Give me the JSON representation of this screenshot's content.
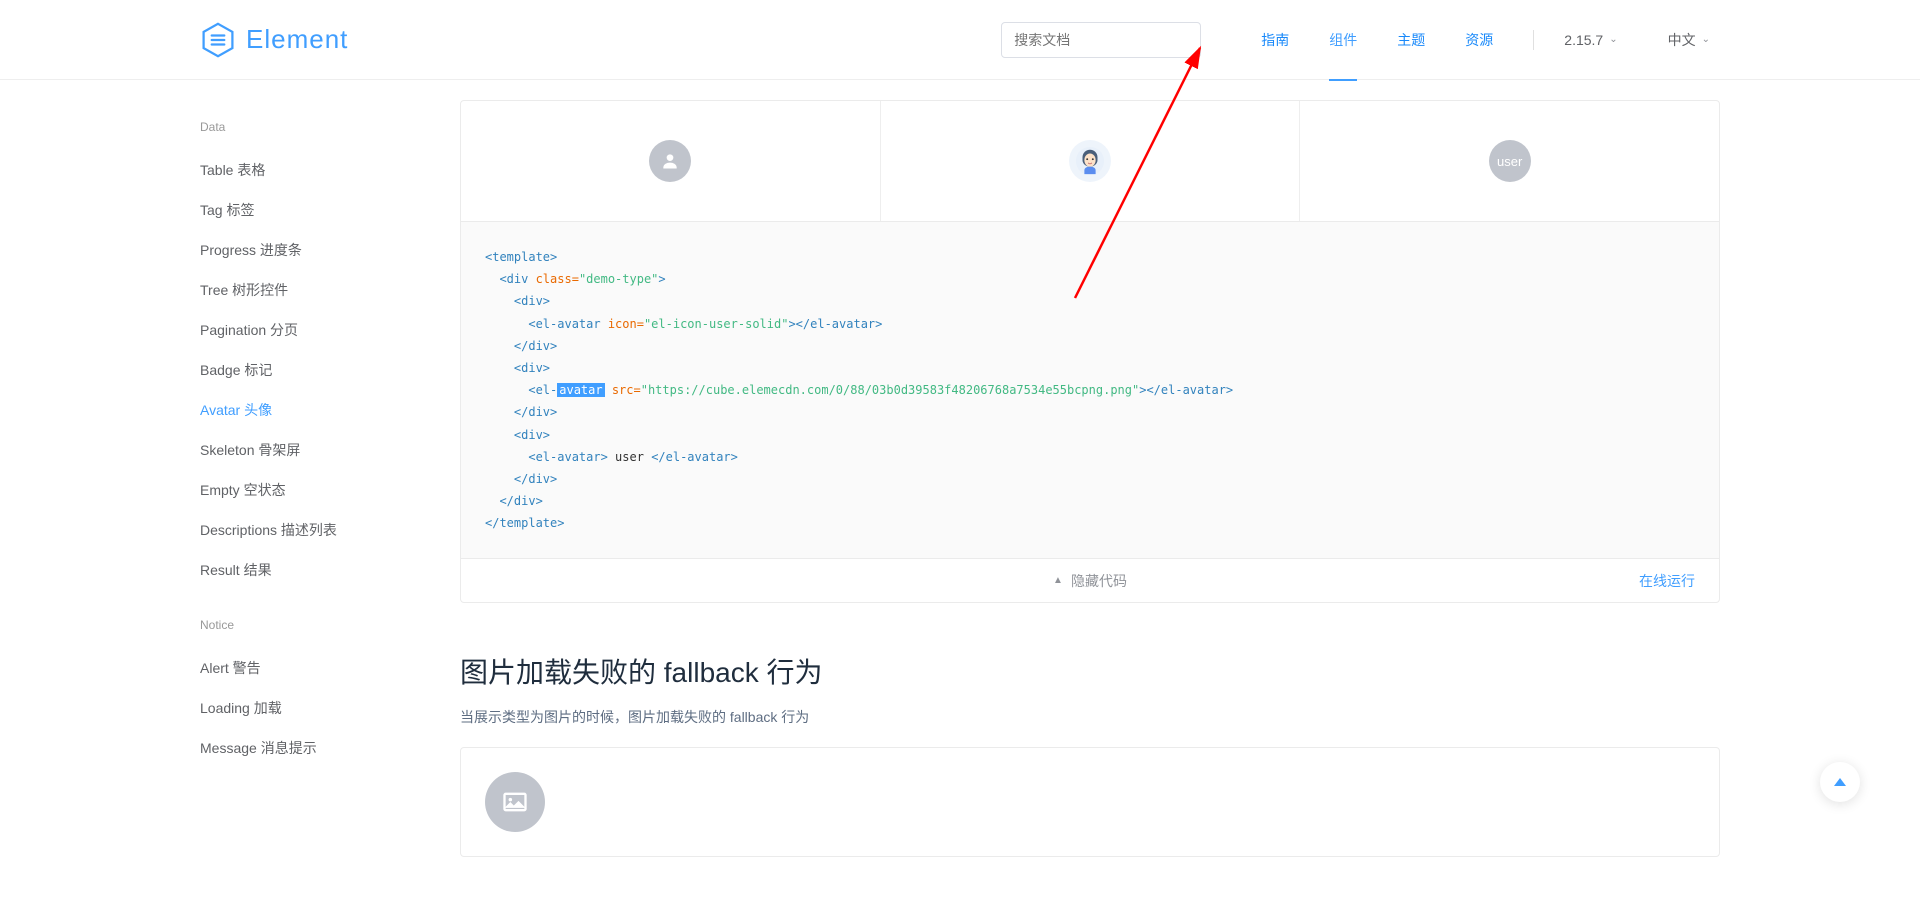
{
  "header": {
    "brand": "Element",
    "search_placeholder": "搜索文档",
    "nav": {
      "guide": "指南",
      "component": "组件",
      "theme": "主题",
      "resource": "资源"
    },
    "version": "2.15.7",
    "lang": "中文"
  },
  "sidebar": {
    "groups": [
      {
        "title": "Data",
        "items": [
          {
            "label": "Table 表格",
            "active": false
          },
          {
            "label": "Tag 标签",
            "active": false
          },
          {
            "label": "Progress 进度条",
            "active": false
          },
          {
            "label": "Tree 树形控件",
            "active": false
          },
          {
            "label": "Pagination 分页",
            "active": false
          },
          {
            "label": "Badge 标记",
            "active": false
          },
          {
            "label": "Avatar 头像",
            "active": true
          },
          {
            "label": "Skeleton 骨架屏",
            "active": false
          },
          {
            "label": "Empty 空状态",
            "active": false
          },
          {
            "label": "Descriptions 描述列表",
            "active": false
          },
          {
            "label": "Result 结果",
            "active": false
          }
        ]
      },
      {
        "title": "Notice",
        "items": [
          {
            "label": "Alert 警告",
            "active": false
          },
          {
            "label": "Loading 加载",
            "active": false
          },
          {
            "label": "Message 消息提示",
            "active": false
          }
        ]
      }
    ]
  },
  "demo": {
    "avatar3_text": "user",
    "code_lines": {
      "l1a": "<template>",
      "l2a": "  <div",
      "l2b": " class=",
      "l2c": "\"demo-type\"",
      "l2d": ">",
      "l3a": "    <div>",
      "l4a": "      <el-avatar",
      "l4b": " icon=",
      "l4c": "\"el-icon-user-solid\"",
      "l4d": "></el-avatar>",
      "l5a": "    </div>",
      "l6a": "    <div>",
      "l7a": "      <el-",
      "l7hl": "avatar",
      "l7b": " src=",
      "l7c": "\"https://cube.elemecdn.com/0/88/03b0d39583f48206768a7534e55bcpng.png\"",
      "l7d": "></el-avatar>",
      "l8a": "    </div>",
      "l9a": "    <div>",
      "l10a": "      <el-avatar>",
      "l10b": " user ",
      "l10c": "</el-avatar>",
      "l11a": "    </div>",
      "l12a": "  </div>",
      "l13a": "</template>"
    },
    "footer_collapse": "隐藏代码",
    "footer_run": "在线运行"
  },
  "fallback": {
    "title": "图片加载失败的 fallback 行为",
    "desc": "当展示类型为图片的时候，图片加载失败的 fallback 行为"
  }
}
